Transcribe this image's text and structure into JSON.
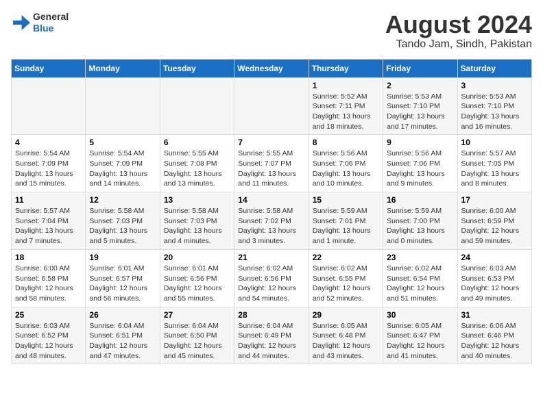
{
  "logo": {
    "general": "General",
    "blue": "Blue"
  },
  "title": "August 2024",
  "subtitle": "Tando Jam, Sindh, Pakistan",
  "days_of_week": [
    "Sunday",
    "Monday",
    "Tuesday",
    "Wednesday",
    "Thursday",
    "Friday",
    "Saturday"
  ],
  "weeks": [
    [
      {
        "day": "",
        "info": ""
      },
      {
        "day": "",
        "info": ""
      },
      {
        "day": "",
        "info": ""
      },
      {
        "day": "",
        "info": ""
      },
      {
        "day": "1",
        "info": "Sunrise: 5:52 AM\nSunset: 7:11 PM\nDaylight: 13 hours\nand 18 minutes."
      },
      {
        "day": "2",
        "info": "Sunrise: 5:53 AM\nSunset: 7:10 PM\nDaylight: 13 hours\nand 17 minutes."
      },
      {
        "day": "3",
        "info": "Sunrise: 5:53 AM\nSunset: 7:10 PM\nDaylight: 13 hours\nand 16 minutes."
      }
    ],
    [
      {
        "day": "4",
        "info": "Sunrise: 5:54 AM\nSunset: 7:09 PM\nDaylight: 13 hours\nand 15 minutes."
      },
      {
        "day": "5",
        "info": "Sunrise: 5:54 AM\nSunset: 7:09 PM\nDaylight: 13 hours\nand 14 minutes."
      },
      {
        "day": "6",
        "info": "Sunrise: 5:55 AM\nSunset: 7:08 PM\nDaylight: 13 hours\nand 13 minutes."
      },
      {
        "day": "7",
        "info": "Sunrise: 5:55 AM\nSunset: 7:07 PM\nDaylight: 13 hours\nand 11 minutes."
      },
      {
        "day": "8",
        "info": "Sunrise: 5:56 AM\nSunset: 7:06 PM\nDaylight: 13 hours\nand 10 minutes."
      },
      {
        "day": "9",
        "info": "Sunrise: 5:56 AM\nSunset: 7:06 PM\nDaylight: 13 hours\nand 9 minutes."
      },
      {
        "day": "10",
        "info": "Sunrise: 5:57 AM\nSunset: 7:05 PM\nDaylight: 13 hours\nand 8 minutes."
      }
    ],
    [
      {
        "day": "11",
        "info": "Sunrise: 5:57 AM\nSunset: 7:04 PM\nDaylight: 13 hours\nand 7 minutes."
      },
      {
        "day": "12",
        "info": "Sunrise: 5:58 AM\nSunset: 7:03 PM\nDaylight: 13 hours\nand 5 minutes."
      },
      {
        "day": "13",
        "info": "Sunrise: 5:58 AM\nSunset: 7:03 PM\nDaylight: 13 hours\nand 4 minutes."
      },
      {
        "day": "14",
        "info": "Sunrise: 5:58 AM\nSunset: 7:02 PM\nDaylight: 13 hours\nand 3 minutes."
      },
      {
        "day": "15",
        "info": "Sunrise: 5:59 AM\nSunset: 7:01 PM\nDaylight: 13 hours\nand 1 minute."
      },
      {
        "day": "16",
        "info": "Sunrise: 5:59 AM\nSunset: 7:00 PM\nDaylight: 13 hours\nand 0 minutes."
      },
      {
        "day": "17",
        "info": "Sunrise: 6:00 AM\nSunset: 6:59 PM\nDaylight: 12 hours\nand 59 minutes."
      }
    ],
    [
      {
        "day": "18",
        "info": "Sunrise: 6:00 AM\nSunset: 6:58 PM\nDaylight: 12 hours\nand 58 minutes."
      },
      {
        "day": "19",
        "info": "Sunrise: 6:01 AM\nSunset: 6:57 PM\nDaylight: 12 hours\nand 56 minutes."
      },
      {
        "day": "20",
        "info": "Sunrise: 6:01 AM\nSunset: 6:56 PM\nDaylight: 12 hours\nand 55 minutes."
      },
      {
        "day": "21",
        "info": "Sunrise: 6:02 AM\nSunset: 6:56 PM\nDaylight: 12 hours\nand 54 minutes."
      },
      {
        "day": "22",
        "info": "Sunrise: 6:02 AM\nSunset: 6:55 PM\nDaylight: 12 hours\nand 52 minutes."
      },
      {
        "day": "23",
        "info": "Sunrise: 6:02 AM\nSunset: 6:54 PM\nDaylight: 12 hours\nand 51 minutes."
      },
      {
        "day": "24",
        "info": "Sunrise: 6:03 AM\nSunset: 6:53 PM\nDaylight: 12 hours\nand 49 minutes."
      }
    ],
    [
      {
        "day": "25",
        "info": "Sunrise: 6:03 AM\nSunset: 6:52 PM\nDaylight: 12 hours\nand 48 minutes."
      },
      {
        "day": "26",
        "info": "Sunrise: 6:04 AM\nSunset: 6:51 PM\nDaylight: 12 hours\nand 47 minutes."
      },
      {
        "day": "27",
        "info": "Sunrise: 6:04 AM\nSunset: 6:50 PM\nDaylight: 12 hours\nand 45 minutes."
      },
      {
        "day": "28",
        "info": "Sunrise: 6:04 AM\nSunset: 6:49 PM\nDaylight: 12 hours\nand 44 minutes."
      },
      {
        "day": "29",
        "info": "Sunrise: 6:05 AM\nSunset: 6:48 PM\nDaylight: 12 hours\nand 43 minutes."
      },
      {
        "day": "30",
        "info": "Sunrise: 6:05 AM\nSunset: 6:47 PM\nDaylight: 12 hours\nand 41 minutes."
      },
      {
        "day": "31",
        "info": "Sunrise: 6:06 AM\nSunset: 6:46 PM\nDaylight: 12 hours\nand 40 minutes."
      }
    ]
  ]
}
